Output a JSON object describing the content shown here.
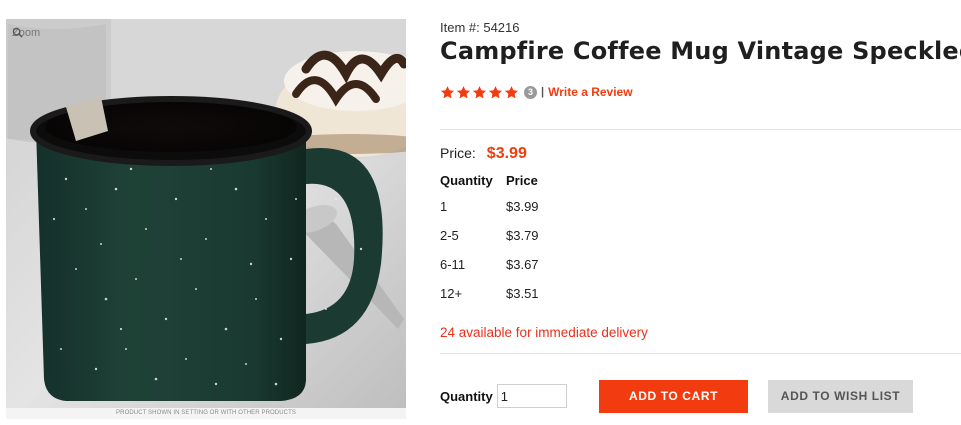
{
  "image": {
    "zoom_label": "Zoom",
    "disclaimer": "PRODUCT SHOWN IN SETTING OR WITH OTHER PRODUCTS",
    "mug_color": "#1f4237"
  },
  "product": {
    "item_number": "Item #: 54216",
    "title": "Campfire Coffee Mug Vintage Speckled",
    "rating_stars": 5,
    "review_count": "3",
    "separator": "|",
    "write_review": "Write a Review",
    "price_label": "Price:",
    "price": "$3.99",
    "tiers": {
      "headers": [
        "Quantity",
        "Price"
      ],
      "rows": [
        [
          "1",
          "$3.99"
        ],
        [
          "2-5",
          "$3.79"
        ],
        [
          "6-11",
          "$3.67"
        ],
        [
          "12+",
          "$3.51"
        ]
      ]
    },
    "availability": "24 available for immediate delivery",
    "quantity_label": "Quantity",
    "quantity_value": "1",
    "add_to_cart": "ADD TO CART",
    "add_to_wishlist": "ADD TO WISH LIST"
  },
  "colors": {
    "accent": "#f23c0f",
    "availability": "#e8301b",
    "wishlist_button": "#d9d9d9"
  }
}
